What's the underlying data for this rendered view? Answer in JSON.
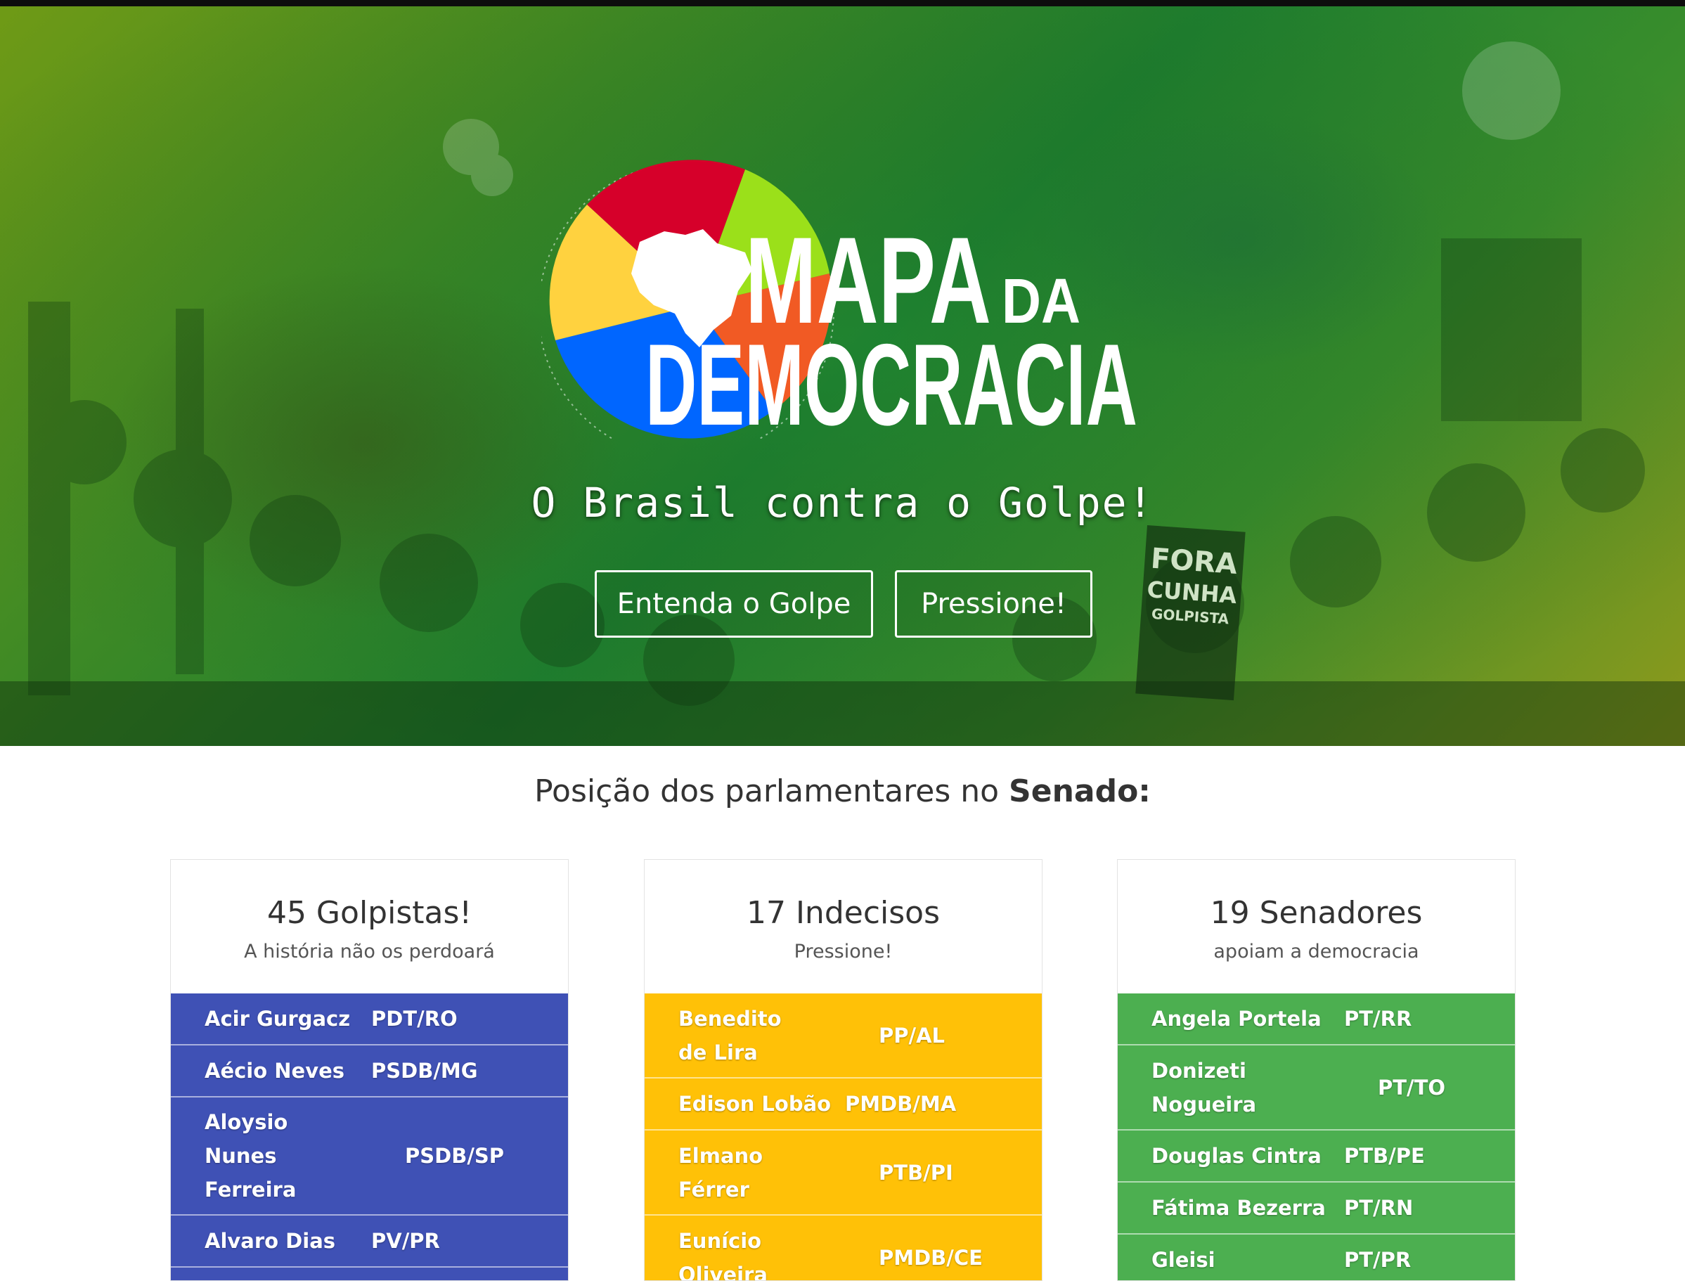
{
  "hero": {
    "logo_title_line1": "MAPA",
    "logo_title_da": "DA",
    "logo_title_line2": "DEMOCRACIA",
    "tagline": "O Brasil contra o Golpe!",
    "btn_entenda": "Entenda o Golpe",
    "btn_pressione": "Pressione!",
    "banner_text": [
      "FORA",
      "CUNHA",
      "GOLPISTA"
    ],
    "colors": {
      "red": "#d6002a",
      "yellow": "#ffd23f",
      "green": "#9be01a",
      "orange": "#f15a24",
      "blue": "#0066ff"
    }
  },
  "section": {
    "title_prefix": "Posição dos parlamentares no ",
    "title_bold": "Senado:"
  },
  "cards": [
    {
      "count": "45 Golpistas!",
      "subtitle": "A história não os perdoará",
      "color": "#3f51b5",
      "rows": [
        {
          "name": "Acir Gurgacz",
          "party": "PDT/RO"
        },
        {
          "name": "Aécio Neves",
          "party": "PSDB/MG"
        },
        {
          "name": "Aloysio Nunes Ferreira",
          "party": "PSDB/SP"
        },
        {
          "name": "Alvaro Dias",
          "party": "PV/PR"
        }
      ]
    },
    {
      "count": "17 Indecisos",
      "subtitle": "Pressione!",
      "color": "#ffc107",
      "rows": [
        {
          "name": "Benedito de Lira",
          "party": "PP/AL"
        },
        {
          "name": "Edison Lobão",
          "party": "PMDB/MA"
        },
        {
          "name": "Elmano Férrer",
          "party": "PTB/PI"
        },
        {
          "name": "Eunício Oliveira",
          "party": "PMDB/CE"
        }
      ]
    },
    {
      "count": "19 Senadores",
      "subtitle": "apoiam a democracia",
      "color": "#4caf50",
      "rows": [
        {
          "name": "Angela Portela",
          "party": "PT/RR"
        },
        {
          "name": "Donizeti Nogueira",
          "party": "PT/TO"
        },
        {
          "name": "Douglas Cintra",
          "party": "PTB/PE"
        },
        {
          "name": "Fátima Bezerra",
          "party": "PT/RN"
        },
        {
          "name": "Gleisi",
          "party": "PT/PR"
        }
      ]
    }
  ]
}
